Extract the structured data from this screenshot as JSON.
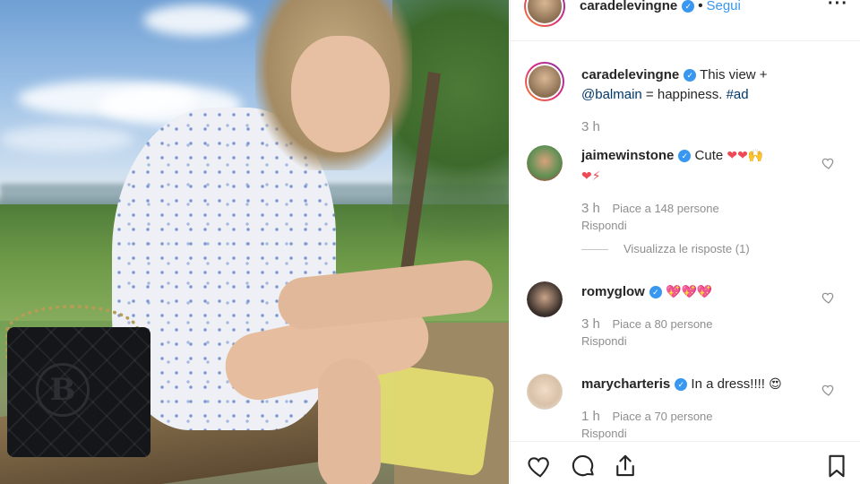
{
  "header": {
    "username": "caradelevingne",
    "verified_mark": "✓",
    "separator": "•",
    "follow_label": "Segui",
    "more_label": "···"
  },
  "caption": {
    "username": "caradelevingne",
    "text_before": "This view +",
    "mention": "@balmain",
    "text_middle": " = happiness. ",
    "hashtag": "#ad",
    "time": "3 h"
  },
  "comments": [
    {
      "username": "jaimewinstone",
      "text": "Cute",
      "emojis": "❤❤🙌",
      "emojis_line2": "❤⚡",
      "time": "3 h",
      "likes": "Piace a 148 persone",
      "reply_label": "Rispondi",
      "view_replies": "Visualizza le risposte (1)"
    },
    {
      "username": "romyglow",
      "text": "",
      "emojis": "💖💖💖",
      "time": "3 h",
      "likes": "Piace a 80 persone",
      "reply_label": "Rispondi"
    },
    {
      "username": "marycharteris",
      "text": "In a dress!!!!",
      "emojis": "😍",
      "time": "1 h",
      "likes": "Piace a 70 persone",
      "reply_label": "Rispondi"
    }
  ],
  "photo": {
    "bag_logo": "B"
  },
  "icons": {
    "like": "heart-icon",
    "comment": "comment-icon",
    "share": "share-icon",
    "save": "bookmark-icon",
    "comment_like": "heart-outline-icon"
  },
  "colors": {
    "verified": "#3897f0",
    "link": "#00376b",
    "meta": "#8e8e8e",
    "heart": "#ed4956"
  }
}
